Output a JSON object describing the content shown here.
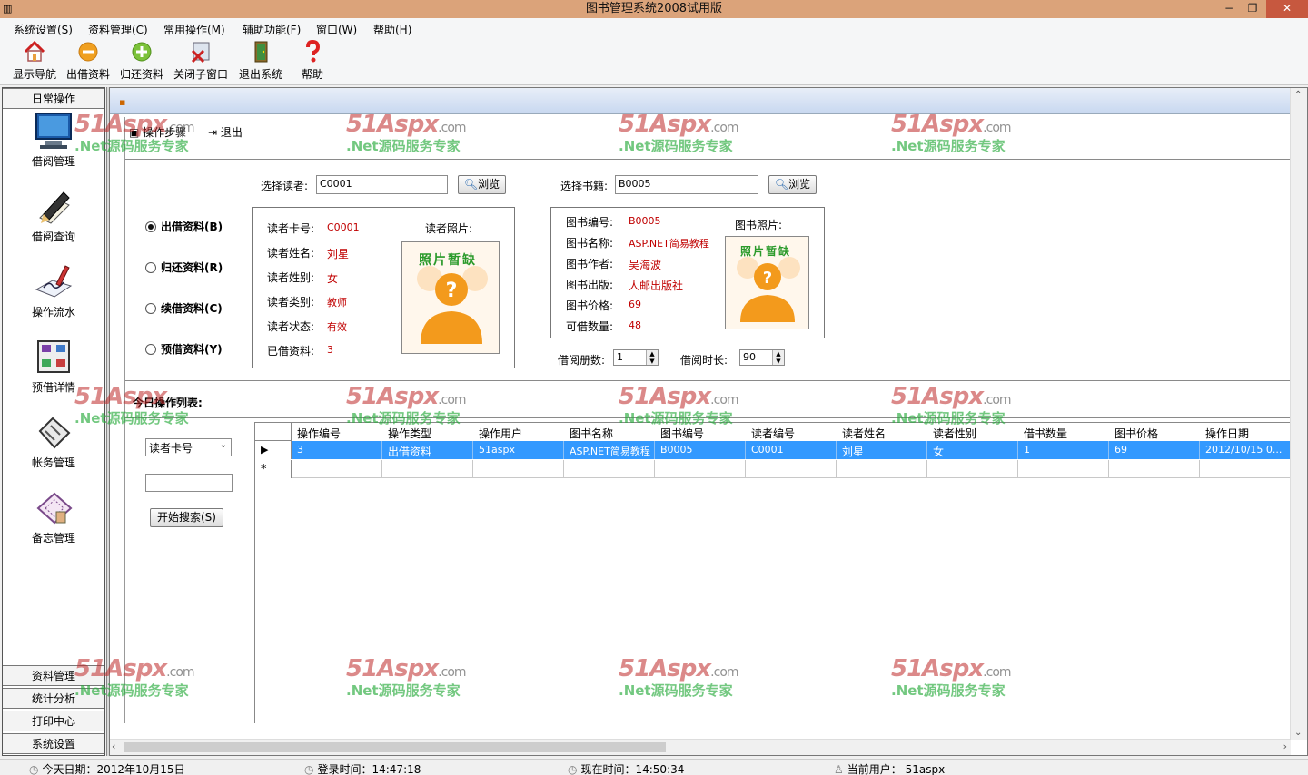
{
  "window": {
    "title": "图书管理系统2008试用版",
    "min": "−",
    "restore": "❐",
    "close": "✕"
  },
  "menu": [
    "系统设置(S)",
    "资料管理(C)",
    "常用操作(M)",
    "辅助功能(F)",
    "窗口(W)",
    "帮助(H)"
  ],
  "toolbar": [
    "显示导航",
    "出借资料",
    "归还资料",
    "关闭子窗口",
    "退出系统",
    "帮助"
  ],
  "nav": {
    "active_group": "日常操作",
    "items": [
      "借阅管理",
      "借阅查询",
      "操作流水",
      "预借详情",
      "帐务管理",
      "备忘管理"
    ],
    "groups": [
      "资料管理",
      "统计分析",
      "打印中心",
      "系统设置"
    ]
  },
  "child": {
    "subtool": [
      "操作步骤",
      "退出"
    ]
  },
  "reader": {
    "select_label": "选择读者:",
    "select_value": "C0001",
    "browse": "浏览",
    "fields": [
      {
        "label": "读者卡号:",
        "value": "C0001"
      },
      {
        "label": "读者姓名:",
        "value": "刘星"
      },
      {
        "label": "读者姓别:",
        "value": "女"
      },
      {
        "label": "读者类别:",
        "value": "教师"
      },
      {
        "label": "读者状态:",
        "value": "有效"
      },
      {
        "label": "已借资料:",
        "value": "3"
      }
    ],
    "photo_label": "读者照片:",
    "photo_text": "照片暂缺"
  },
  "book": {
    "select_label": "选择书籍:",
    "select_value": "B0005",
    "browse": "浏览",
    "fields": [
      {
        "label": "图书编号:",
        "value": "B0005"
      },
      {
        "label": "图书名称:",
        "value": "ASP.NET简易教程"
      },
      {
        "label": "图书作者:",
        "value": "吴海波"
      },
      {
        "label": "图书出版:",
        "value": "人邮出版社"
      },
      {
        "label": "图书价格:",
        "value": "69"
      },
      {
        "label": "可借数量:",
        "value": "48"
      }
    ],
    "photo_label": "图书照片:",
    "photo_text": "照片暂缺"
  },
  "modes": [
    {
      "label": "出借资料(B)",
      "checked": true
    },
    {
      "label": "归还资料(R)",
      "checked": false
    },
    {
      "label": "续借资料(C)",
      "checked": false
    },
    {
      "label": "预借资料(Y)",
      "checked": false
    }
  ],
  "borrow": {
    "count_label": "借阅册数:",
    "count_value": "1",
    "days_label": "借阅时长:",
    "days_value": "90"
  },
  "list": {
    "title": "今日操作列表:",
    "search_field": "读者卡号",
    "search_value": "",
    "search_button": "开始搜索(S)",
    "columns": [
      "操作编号",
      "操作类型",
      "操作用户",
      "图书名称",
      "图书编号",
      "读者编号",
      "读者姓名",
      "读者性别",
      "借书数量",
      "图书价格",
      "操作日期"
    ],
    "rows": [
      [
        "3",
        "出借资料",
        "51aspx",
        "ASP.NET简易教程",
        "B0005",
        "C0001",
        "刘星",
        "女",
        "1",
        "69",
        "2012/10/15 0..."
      ]
    ],
    "selected_marker": "▶",
    "new_marker": "*"
  },
  "status": {
    "date": "今天日期：2012年10月15日",
    "login": "登录时间：14:47:18",
    "now": "现在时间：14:50:34",
    "user": "当前用户： 51aspx"
  },
  "watermark": {
    "brand": "51Aspx",
    "domain": ".com",
    "slogan": ".Net源码服务专家"
  },
  "colors": {
    "titlebar": "#dba37a",
    "selection": "#3399ff",
    "value_red": "#c00000"
  }
}
